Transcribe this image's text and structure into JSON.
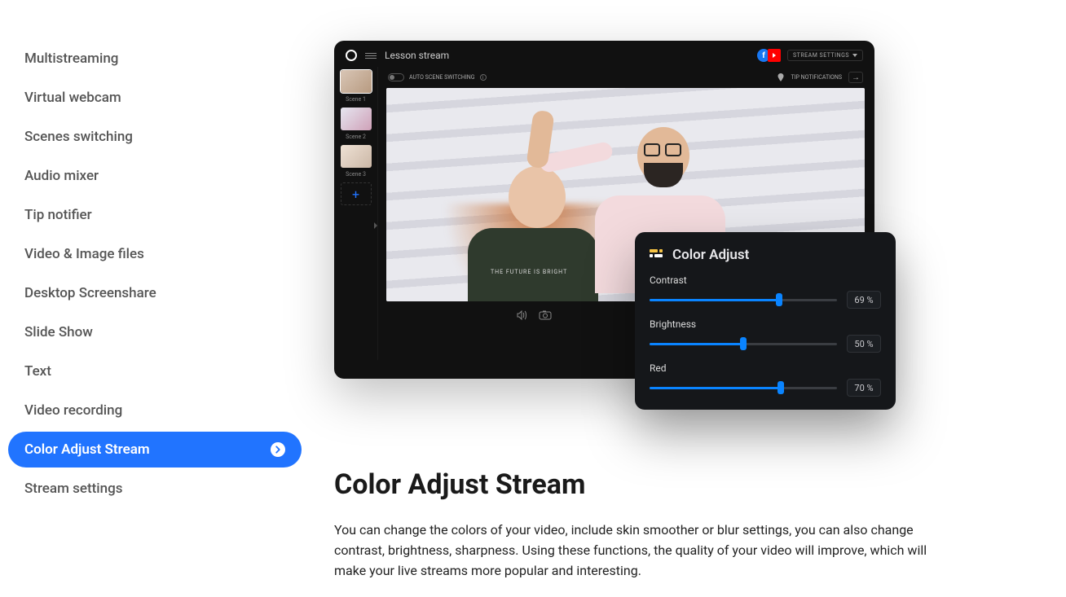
{
  "sidebar": {
    "items": [
      {
        "label": "Multistreaming"
      },
      {
        "label": "Virtual webcam"
      },
      {
        "label": "Scenes switching"
      },
      {
        "label": "Audio mixer"
      },
      {
        "label": "Tip notifier"
      },
      {
        "label": "Video & Image files"
      },
      {
        "label": "Desktop Screenshare"
      },
      {
        "label": "Slide Show"
      },
      {
        "label": "Text"
      },
      {
        "label": "Video recording"
      },
      {
        "label": "Color Adjust Stream"
      },
      {
        "label": "Stream settings"
      }
    ],
    "active_index": 10
  },
  "app": {
    "title": "Lesson stream",
    "auto_scene": "AUTO SCENE SWITCHING",
    "tip_notifications": "TIP NOTIFICATIONS",
    "stream_settings_btn": "STREAM SETTINGS",
    "scenes": [
      {
        "label": "Scene 1"
      },
      {
        "label": "Scene 2"
      },
      {
        "label": "Scene 3"
      }
    ],
    "add_scene": "+",
    "shirt_text": "THE FUTURE IS BRIGHT"
  },
  "color_panel": {
    "title": "Color Adjust",
    "sliders": [
      {
        "label": "Contrast",
        "value": 69,
        "display": "69 %"
      },
      {
        "label": "Brightness",
        "value": 50,
        "display": "50 %"
      },
      {
        "label": "Red",
        "value": 70,
        "display": "70 %"
      }
    ]
  },
  "article": {
    "heading": "Color Adjust Stream",
    "body": "You can change the colors of your video, include skin smoother or blur settings, you can also change contrast, brightness, sharpness. Using these functions, the quality of your video will improve, which will make your live streams more popular and interesting."
  },
  "colors": {
    "accent": "#2174ff"
  }
}
